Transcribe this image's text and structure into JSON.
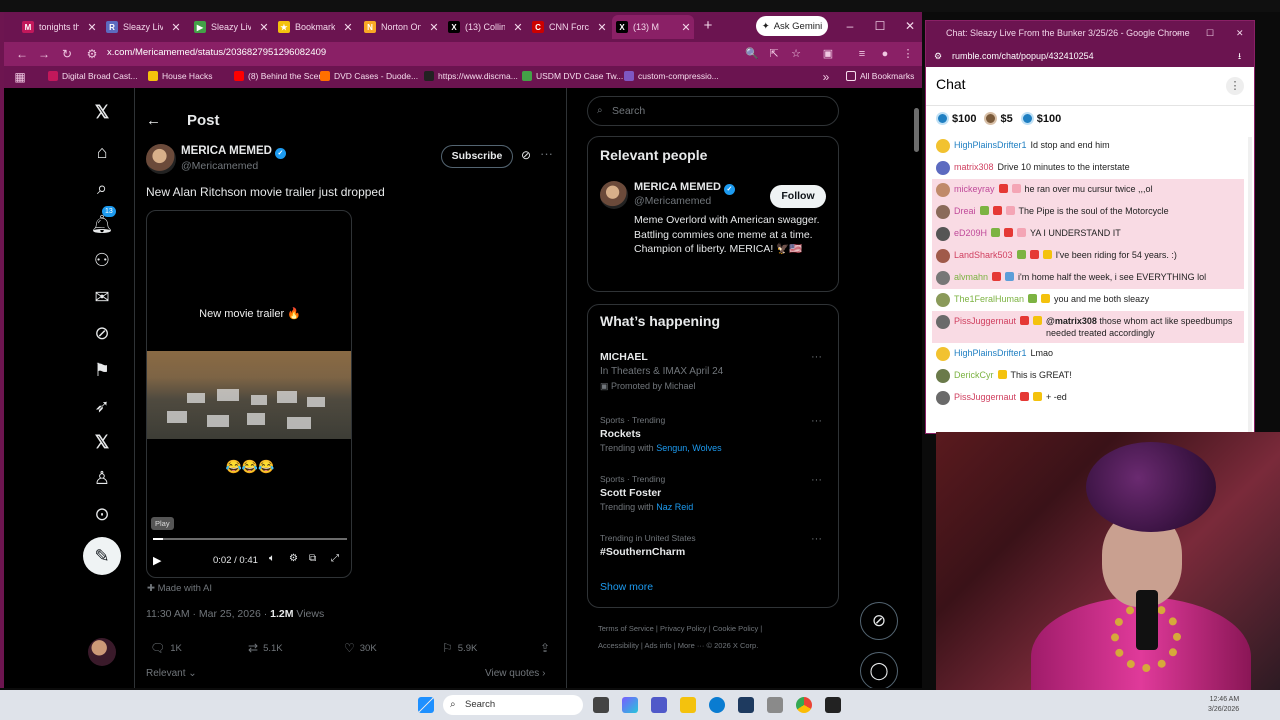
{
  "browser": {
    "tabs": [
      {
        "label": "tonights th",
        "color": "#c2185b",
        "glyph": "M"
      },
      {
        "label": "Sleazy Live",
        "color": "#5c6bc0",
        "glyph": "R"
      },
      {
        "label": "Sleazy Live",
        "color": "#43a047",
        "glyph": "▶"
      },
      {
        "label": "Bookmarks",
        "color": "#f4c20d",
        "glyph": "★"
      },
      {
        "label": "Norton On",
        "color": "#f9a825",
        "glyph": "N"
      },
      {
        "label": "(13) Collin",
        "color": "#000000",
        "glyph": "X"
      },
      {
        "label": "CNN Force",
        "color": "#cc0000",
        "glyph": "C"
      },
      {
        "label": "(13) M",
        "color": "#000000",
        "glyph": "X"
      }
    ],
    "gemini_label": "Ask Gemini",
    "url": "x.com/Mericamemed/status/2036827951296082409",
    "bookmarks": [
      {
        "label": "Digital Broad Cast...",
        "color": "#c2185b"
      },
      {
        "label": "House Hacks",
        "color": "#f4c20d"
      },
      {
        "label": "(8) Behind the Scen...",
        "color": "#ff0000"
      },
      {
        "label": "DVD Cases - Duode...",
        "color": "#ff6f00"
      },
      {
        "label": "https://www.discma...",
        "color": "#222222"
      },
      {
        "label": "USDM DVD Case Tw...",
        "color": "#43a047"
      },
      {
        "label": "custom-compressio...",
        "color": "#7e57c2"
      }
    ],
    "all_bookmarks": "All Bookmarks"
  },
  "x": {
    "nav_icons": [
      "x-logo",
      "home",
      "search",
      "notifications",
      "follow",
      "messages",
      "grok",
      "bookmarks",
      "premium",
      "x-premium",
      "profile",
      "more"
    ],
    "notif_count": "13",
    "header_title": "Post",
    "author_name": "MERICA MEMED",
    "author_handle": "@Mericamemed",
    "subscribe_label": "Subscribe",
    "post_text": "New Alan Ritchson movie trailer just dropped",
    "video": {
      "caption": "New movie trailer 🔥",
      "emoji": "😂😂😂",
      "tooltip": "Play",
      "time": "0:02 / 0:41",
      "progress": 0.05
    },
    "made_with_ai": "Made with AI",
    "meta_time": "11:30 AM · Mar 25, 2026 · ",
    "meta_views": "1.2M",
    "meta_views_label": " Views",
    "actions": {
      "replies": "1K",
      "reposts": "5.1K",
      "likes": "30K",
      "bookmarks": "5.9K"
    },
    "relevant_label": "Relevant",
    "view_quotes_label": "View quotes",
    "search_placeholder": "Search",
    "relevant_people": {
      "title": "Relevant people",
      "name": "MERICA MEMED",
      "handle": "@Mericamemed",
      "follow_label": "Follow",
      "bio": "Meme Overlord with American swagger. Battling commies one meme at a time. Champion of liberty. MERICA! 🦅🇺🇸"
    },
    "happening": {
      "title": "What’s happening",
      "trends": [
        {
          "category": "",
          "name": "MICHAEL",
          "sub": "In Theaters & IMAX April 24",
          "sub2": "Promoted by Michael",
          "highlight": ""
        },
        {
          "category": "Sports · Trending",
          "name": "Rockets",
          "sub": "Trending with ",
          "highlight": "Sengun, Wolves"
        },
        {
          "category": "Sports · Trending",
          "name": "Scott Foster",
          "sub": "Trending with ",
          "highlight": "Naz Reid"
        },
        {
          "category": "Trending in United States",
          "name": "#SouthernCharm",
          "sub": "",
          "highlight": ""
        }
      ],
      "show_more": "Show more"
    },
    "footer": {
      "line1": "Terms of Service  |  Privacy Policy  |  Cookie Policy  |",
      "line2": "Accessibility  |  Ads info  |  More ···  © 2026 X Corp."
    }
  },
  "chat": {
    "window_title": "Chat: Sleazy Live From the Bunker 3/25/26 - Google Chrome",
    "url": "rumble.com/chat/popup/432410254",
    "header": "Chat",
    "rants": [
      {
        "amount": "$100",
        "coin": "blue"
      },
      {
        "amount": "$5",
        "coin": "brown"
      },
      {
        "amount": "$100",
        "coin": "blue"
      }
    ],
    "messages": [
      {
        "user": "HighPlainsDrifter1",
        "color": "#1f7fc2",
        "avatar": "#f2c230",
        "text": "Id stop and end him",
        "hl": false,
        "badges": []
      },
      {
        "user": "matrix308",
        "color": "#d04060",
        "avatar": "#5c6bc0",
        "text": "Drive 10 minutes to the interstate",
        "hl": false,
        "badges": []
      },
      {
        "user": "mickeyray",
        "color": "#c04a9a",
        "avatar": "#c08a6a",
        "text": "he ran over mu cursur twice ,,,ol",
        "hl": true,
        "badges": [
          "#e53935",
          "#f4a5b5"
        ]
      },
      {
        "user": "Dreai",
        "color": "#c04a9a",
        "avatar": "#8a6a5a",
        "text": "The Pipe is the soul of the Motorcycle",
        "hl": true,
        "badges": [
          "#7cb342",
          "#e53935",
          "#f4a5b5"
        ]
      },
      {
        "user": "eD209H",
        "color": "#c04a9a",
        "avatar": "#555555",
        "text": "YA I UNDERSTAND IT",
        "hl": true,
        "badges": [
          "#7cb342",
          "#e53935",
          "#f4a5b5"
        ]
      },
      {
        "user": "LandShark503",
        "color": "#d04060",
        "avatar": "#a05a4a",
        "text": "I've been riding for 54 years. :)",
        "hl": true,
        "badges": [
          "#7cb342",
          "#e53935",
          "#f4c20d"
        ]
      },
      {
        "user": "alvmahn",
        "color": "#7cb342",
        "avatar": "#777777",
        "text": "i'm home half the week, i see EVERYTHING lol",
        "hl": true,
        "badges": [
          "#e53935",
          "#5c9ed8"
        ]
      },
      {
        "user": "The1FeralHuman",
        "color": "#7cb342",
        "avatar": "#8a9a5a",
        "text": "you and me both sleazy",
        "hl": false,
        "badges": [
          "#7cb342",
          "#f4c20d"
        ]
      },
      {
        "user": "PissJuggernaut",
        "color": "#d04060",
        "avatar": "#6a6a6a",
        "mention": "@matrix308",
        "text": " those whom act like speedbumps needed treated accordingly",
        "hl": true,
        "badges": [
          "#e53935",
          "#f4c20d"
        ]
      },
      {
        "user": "HighPlainsDrifter1",
        "color": "#1f7fc2",
        "avatar": "#f2c230",
        "text": "Lmao",
        "hl": false,
        "badges": []
      },
      {
        "user": "DerickCyr",
        "color": "#7cb342",
        "avatar": "#6a7a4a",
        "text": "This is GREAT!",
        "hl": false,
        "badges": [
          "#f4c20d"
        ]
      },
      {
        "user": "PissJuggernaut",
        "color": "#d04060",
        "avatar": "#6a6a6a",
        "text": "+ -ed",
        "hl": false,
        "badges": [
          "#e53935",
          "#f4c20d"
        ]
      }
    ]
  },
  "taskbar": {
    "search_label": "Search",
    "clock_time": "12:46 AM",
    "clock_date": "3/26/2026",
    "apps": [
      "windows",
      "search",
      "task-view",
      "copilot",
      "teams",
      "files",
      "edge",
      "store",
      "dev-tools",
      "chrome",
      "app"
    ]
  }
}
